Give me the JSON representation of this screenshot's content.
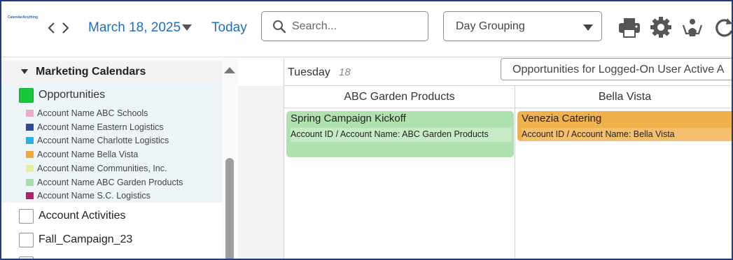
{
  "toolbar": {
    "logo_text": "CalendarAnything",
    "date": "March 18, 2025",
    "today_label": "Today",
    "search_placeholder": "Search...",
    "grouping_value": "Day Grouping",
    "icons": [
      "chevron-left-icon",
      "chevron-right-icon",
      "print-icon",
      "gear-icon",
      "meeting-icon",
      "refresh-icon"
    ]
  },
  "sidebar": {
    "group_title": "Marketing Calendars",
    "opportunities": {
      "label": "Opportunities",
      "color": "#17c93a",
      "accounts": [
        {
          "label": "Account Name ABC Schools",
          "color": "#f0a8c8"
        },
        {
          "label": "Account Name Eastern Logistics",
          "color": "#2f4a9a"
        },
        {
          "label": "Account Name Charlotte Logistics",
          "color": "#2ab0e8"
        },
        {
          "label": "Account Name Bella Vista",
          "color": "#f0a73c"
        },
        {
          "label": "Account Name Communities, Inc.",
          "color": "#e6ee9c"
        },
        {
          "label": "Account Name ABC Garden Products",
          "color": "#a8dca8"
        },
        {
          "label": "Account Name S.C. Logistics",
          "color": "#a8246a"
        }
      ]
    },
    "calendars": [
      {
        "label": "Account Activities"
      },
      {
        "label": "Fall_Campaign_23"
      }
    ]
  },
  "day_header": {
    "day_name": "Tuesday",
    "day_number": "18",
    "filter_value": "Opportunities for Logged-On User Active A"
  },
  "columns": [
    {
      "name": "ABC Garden Products",
      "event": {
        "title": "Spring Campaign Kickoff",
        "detail": "Account ID / Account Name: ABC Garden Products",
        "color": "#b0e2b0",
        "detail_color": "#c7ebc7"
      }
    },
    {
      "name": "Bella Vista",
      "event": {
        "title": "Venezia Catering",
        "detail": "Account ID / Account Name: Bella Vista",
        "color": "#f0b04a",
        "detail_color": "#f4c070"
      }
    }
  ]
}
